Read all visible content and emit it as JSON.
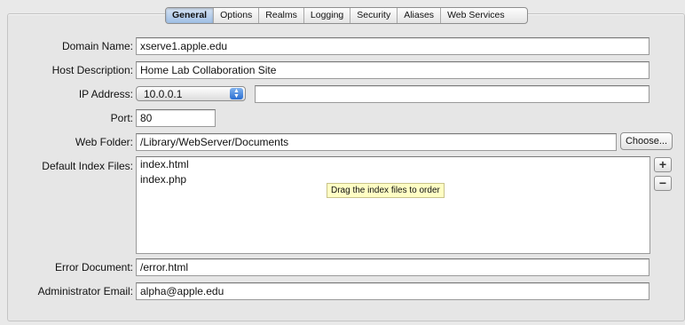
{
  "tabs": [
    "General",
    "Options",
    "Realms",
    "Logging",
    "Security",
    "Aliases",
    "Web Services"
  ],
  "form": {
    "domain_name": {
      "label": "Domain Name:",
      "value": "xserve1.apple.edu"
    },
    "host_description": {
      "label": "Host Description:",
      "value": "Home Lab Collaboration Site"
    },
    "ip_address": {
      "label": "IP Address:",
      "value": "10.0.0.1",
      "extra": ""
    },
    "port": {
      "label": "Port:",
      "value": "80"
    },
    "web_folder": {
      "label": "Web Folder:",
      "value": "/Library/WebServer/Documents",
      "choose_label": "Choose..."
    },
    "default_index": {
      "label": "Default Index Files:",
      "items": [
        "index.html",
        "index.php"
      ],
      "add_label": "+",
      "remove_label": "−",
      "tooltip": "Drag the index files to order"
    },
    "error_document": {
      "label": "Error Document:",
      "value": "/error.html"
    },
    "admin_email": {
      "label": "Administrator Email:",
      "value": "alpha@apple.edu"
    }
  }
}
